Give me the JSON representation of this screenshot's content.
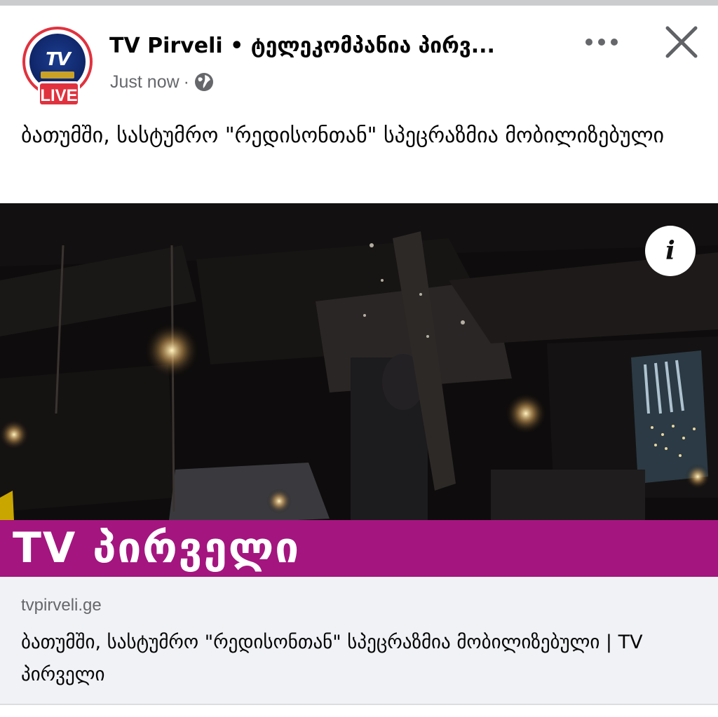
{
  "post": {
    "page_name": "TV Pirveli • ტელეკომპანია პირვ...",
    "timestamp": "Just now",
    "separator": "·",
    "audience_icon": "globe-icon",
    "more_icon": "more-dots-icon",
    "close_icon": "close-icon",
    "text": "ბათუმში, სასტუმრო \"რედისონთან\" სპეცრაზმია მობილიზებული"
  },
  "avatar": {
    "logo_text": "TV",
    "live_label": "LIVE"
  },
  "video": {
    "info_label": "i",
    "banner_text": "TV პირველი"
  },
  "link": {
    "domain": "tvpirveli.ge",
    "title": "ბათუმში, სასტუმრო \"რედისონთან\" სპეცრაზმია მობილიზებული | TV პირველი"
  },
  "colors": {
    "accent_red": "#e0323e",
    "banner_magenta": "#a4157f",
    "secondary_text": "#65676b",
    "link_background": "#f0f2f5"
  }
}
